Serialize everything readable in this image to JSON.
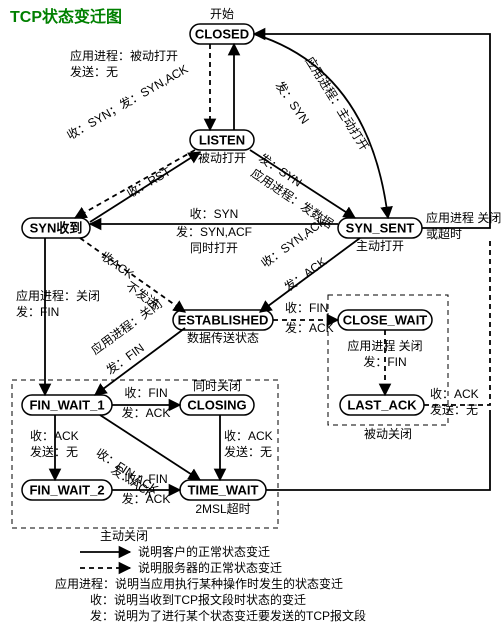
{
  "title": "TCP状态变迁图",
  "states": {
    "closed": "CLOSED",
    "listen": "LISTEN",
    "syn_recv": "SYN收到",
    "syn_sent": "SYN_SENT",
    "established": "ESTABLISHED",
    "close_wait": "CLOSE_WAIT",
    "last_ack": "LAST_ACK",
    "fin_wait_1": "FIN_WAIT_1",
    "closing": "CLOSING",
    "fin_wait_2": "FIN_WAIT_2",
    "time_wait": "TIME_WAIT"
  },
  "labels": {
    "start": "开始",
    "closed_to_listen_1": "应用进程：被动打开",
    "closed_to_listen_2": "发送：无",
    "closed_to_synsent_1": "应用进程：主动打开",
    "closed_to_synsent_2": "发：SYN",
    "listen_note": "被动打开",
    "listen_to_synsent_1": "应用进程：发数据",
    "listen_to_synsent_2": "发：SYN",
    "listen_to_synrecv_1": "收：SYN；发：SYN,ACK",
    "synrecv_to_listen": "收：RST",
    "synsent_note": "主动打开",
    "synsent_close_1": "应用进程 关闭",
    "synsent_close_2": "或超时",
    "synsent_to_synrecv_1": "收：SYN",
    "synsent_to_synrecv_2": "发：SYN,ACF",
    "synsent_to_synrecv_3": "同时打开",
    "synrecv_to_est": "收ACK",
    "synrecv_to_est_2": "不发送",
    "synsent_to_est_1": "收：SYN,ACK",
    "synsent_to_est_2": "发：ACK",
    "est_note": "数据传送状态",
    "synrecv_to_fw1_1": "应用进程：关闭",
    "synrecv_to_fw1_2": "发：FIN",
    "est_to_fw1_1": "应用进程：关闭",
    "est_to_fw1_2": "发：FIN",
    "est_to_cw_1": "收：FIN",
    "est_to_cw_2": "发：ACK",
    "cw_to_la_1": "应用进程 关闭",
    "cw_to_la_2": "发：FIN",
    "la_to_closed_1": "收：ACK",
    "la_to_closed_2": "发送：无",
    "passive_close_box": "被动关闭",
    "fw1_to_closing_1": "收：FIN",
    "fw1_to_closing_2": "发：ACK",
    "closing_note": "同时关闭",
    "fw1_to_fw2_1": "收：ACK",
    "fw1_to_fw2_2": "发送：无",
    "fw1_to_tw_1": "收：FIN,ACK",
    "fw1_to_tw_2": "发：ACK",
    "closing_to_tw_1": "收：ACK",
    "closing_to_tw_2": "发送：无",
    "fw2_to_tw_1": "收：FIN",
    "fw2_to_tw_2": "发：ACK",
    "tw_note": "2MSL超时",
    "active_close_box": "主动关闭",
    "legend_solid": "说明客户的正常状态变迁",
    "legend_dash": "说明服务器的正常状态变迁",
    "legend_app": "应用进程：说明当应用执行某种操作时发生的状态变迁",
    "legend_recv": "收：说明当收到TCP报文段时状态的变迁",
    "legend_send": "发：说明为了进行某个状态变迁要发送的TCP报文段"
  }
}
